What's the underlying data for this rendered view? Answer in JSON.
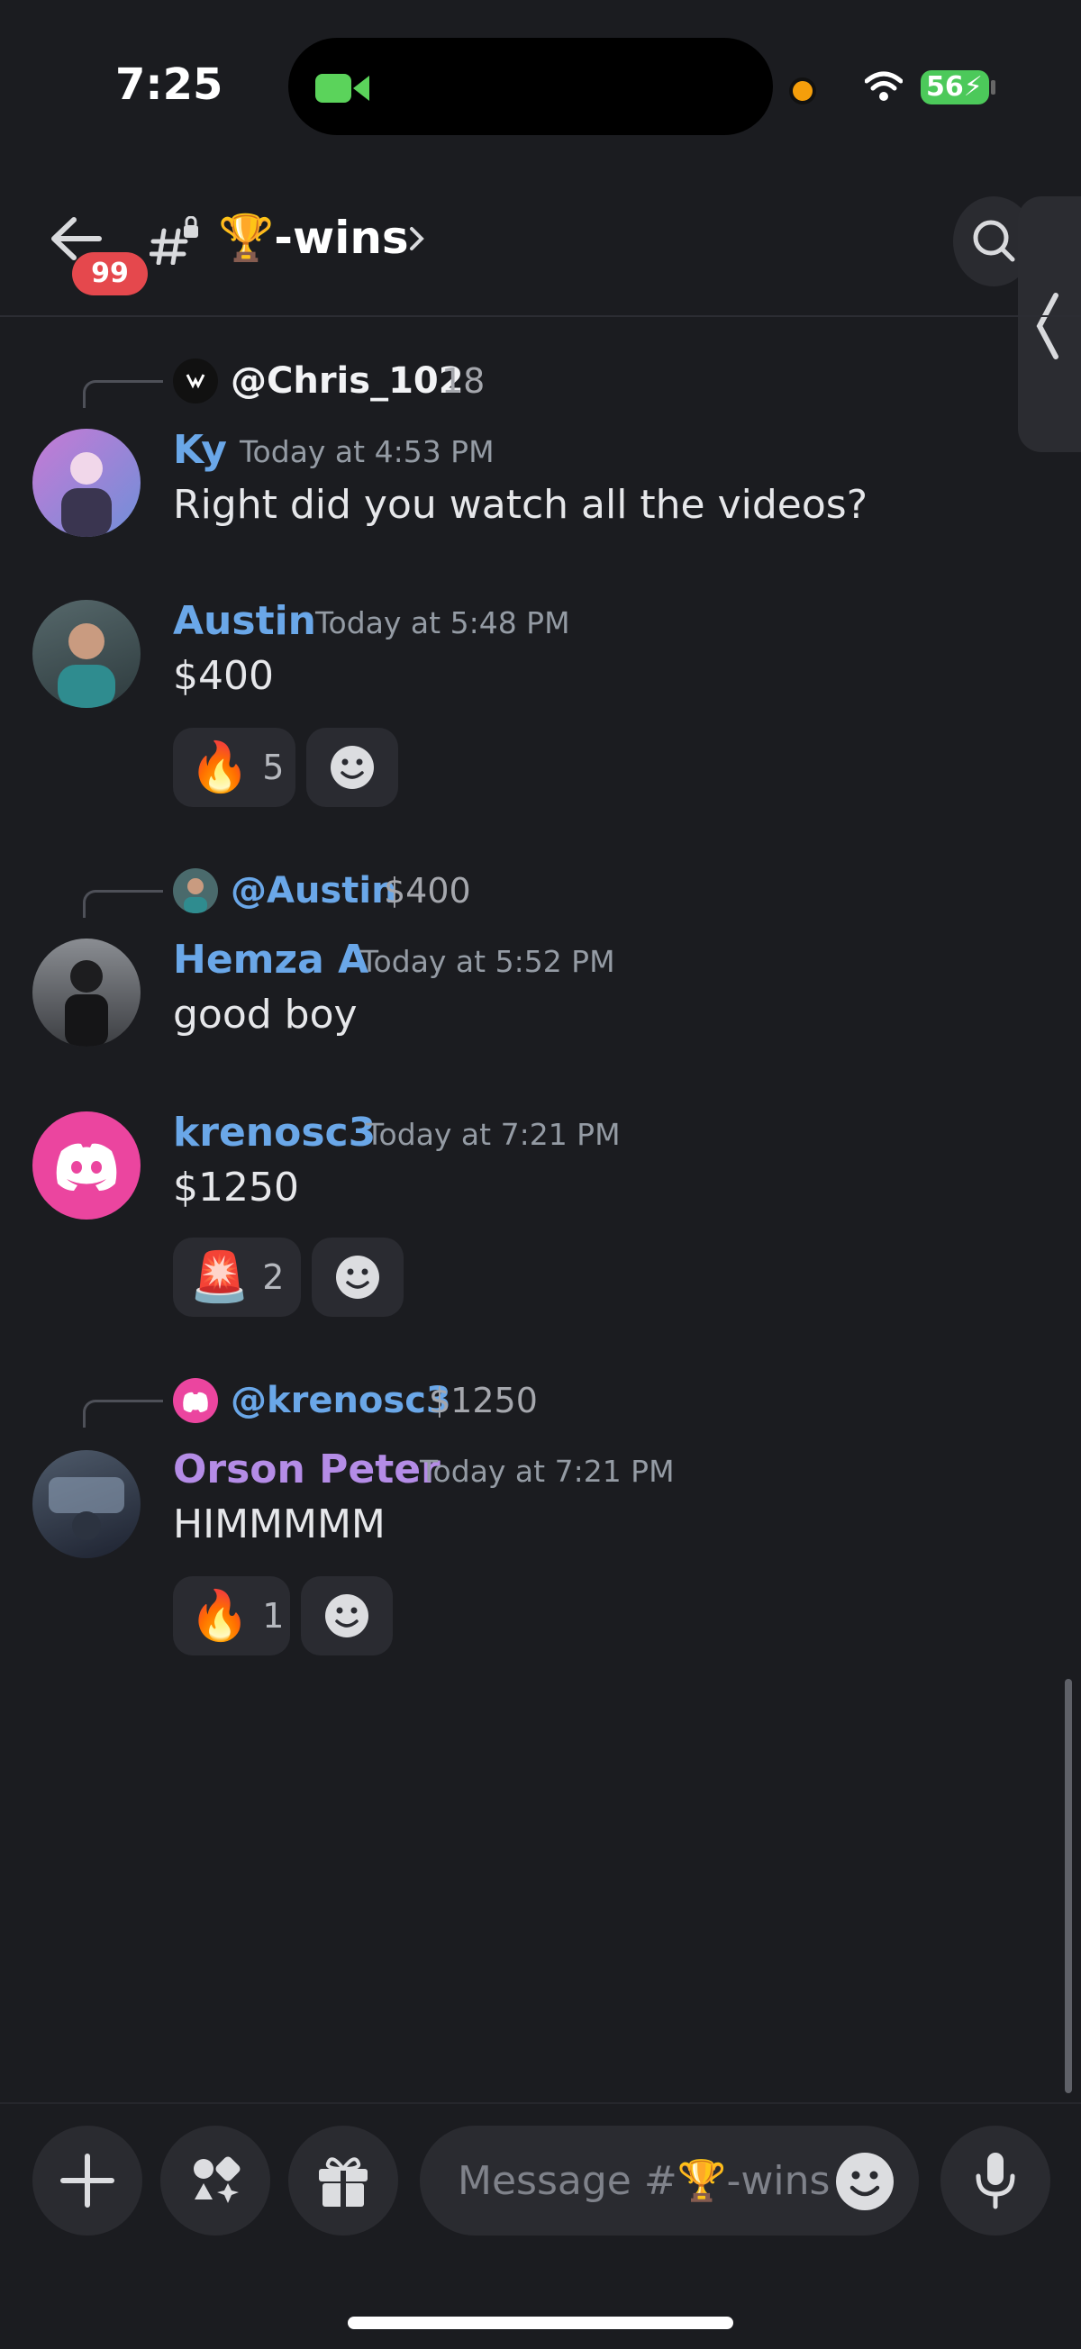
{
  "status_bar": {
    "time": "7:25",
    "battery": "56"
  },
  "header": {
    "unread_badge": "99",
    "channel_name": "🏆-wins"
  },
  "messages": [
    {
      "reply_to": {
        "name": "@Chris_102",
        "text": "18"
      },
      "author": "Ky",
      "timestamp": "Today at 4:53 PM",
      "text": "Right did you watch all the videos?"
    },
    {
      "author": "Austin",
      "timestamp": "Today at 5:48 PM",
      "text": "$400",
      "reaction": {
        "emoji": "🔥",
        "count": "5"
      }
    },
    {
      "reply_to": {
        "name": "@Austin",
        "text": "$400"
      },
      "author": "Hemza A",
      "timestamp": "Today at 5:52 PM",
      "text": "good boy"
    },
    {
      "author": "krenosc3",
      "timestamp": "Today at 7:21 PM",
      "text": "$1250",
      "reaction": {
        "emoji": "🚨",
        "count": "2"
      }
    },
    {
      "reply_to": {
        "name": "@krenosc3",
        "text": "$1250"
      },
      "author": "Orson Peter",
      "timestamp": "Today at 7:21 PM",
      "text": "HIMMMMM",
      "reaction": {
        "emoji": "🔥",
        "count": "1"
      }
    }
  ],
  "composer": {
    "placeholder": "Message #🏆-wins"
  },
  "colors": {
    "background": "#1b1c20",
    "author_blue": "#6aa7e8",
    "author_purple": "#b48ce6",
    "discord_pink": "#eb459f",
    "badge_red": "#e5484d"
  },
  "icons": [
    "video-camera-icon",
    "wifi-icon",
    "back-arrow-icon",
    "locked-hash-icon",
    "chevron-right-icon",
    "search-icon",
    "chevron-left-icon",
    "smiley-add-icon",
    "plus-icon",
    "apps-icon",
    "gift-icon",
    "emoji-icon",
    "microphone-icon"
  ]
}
